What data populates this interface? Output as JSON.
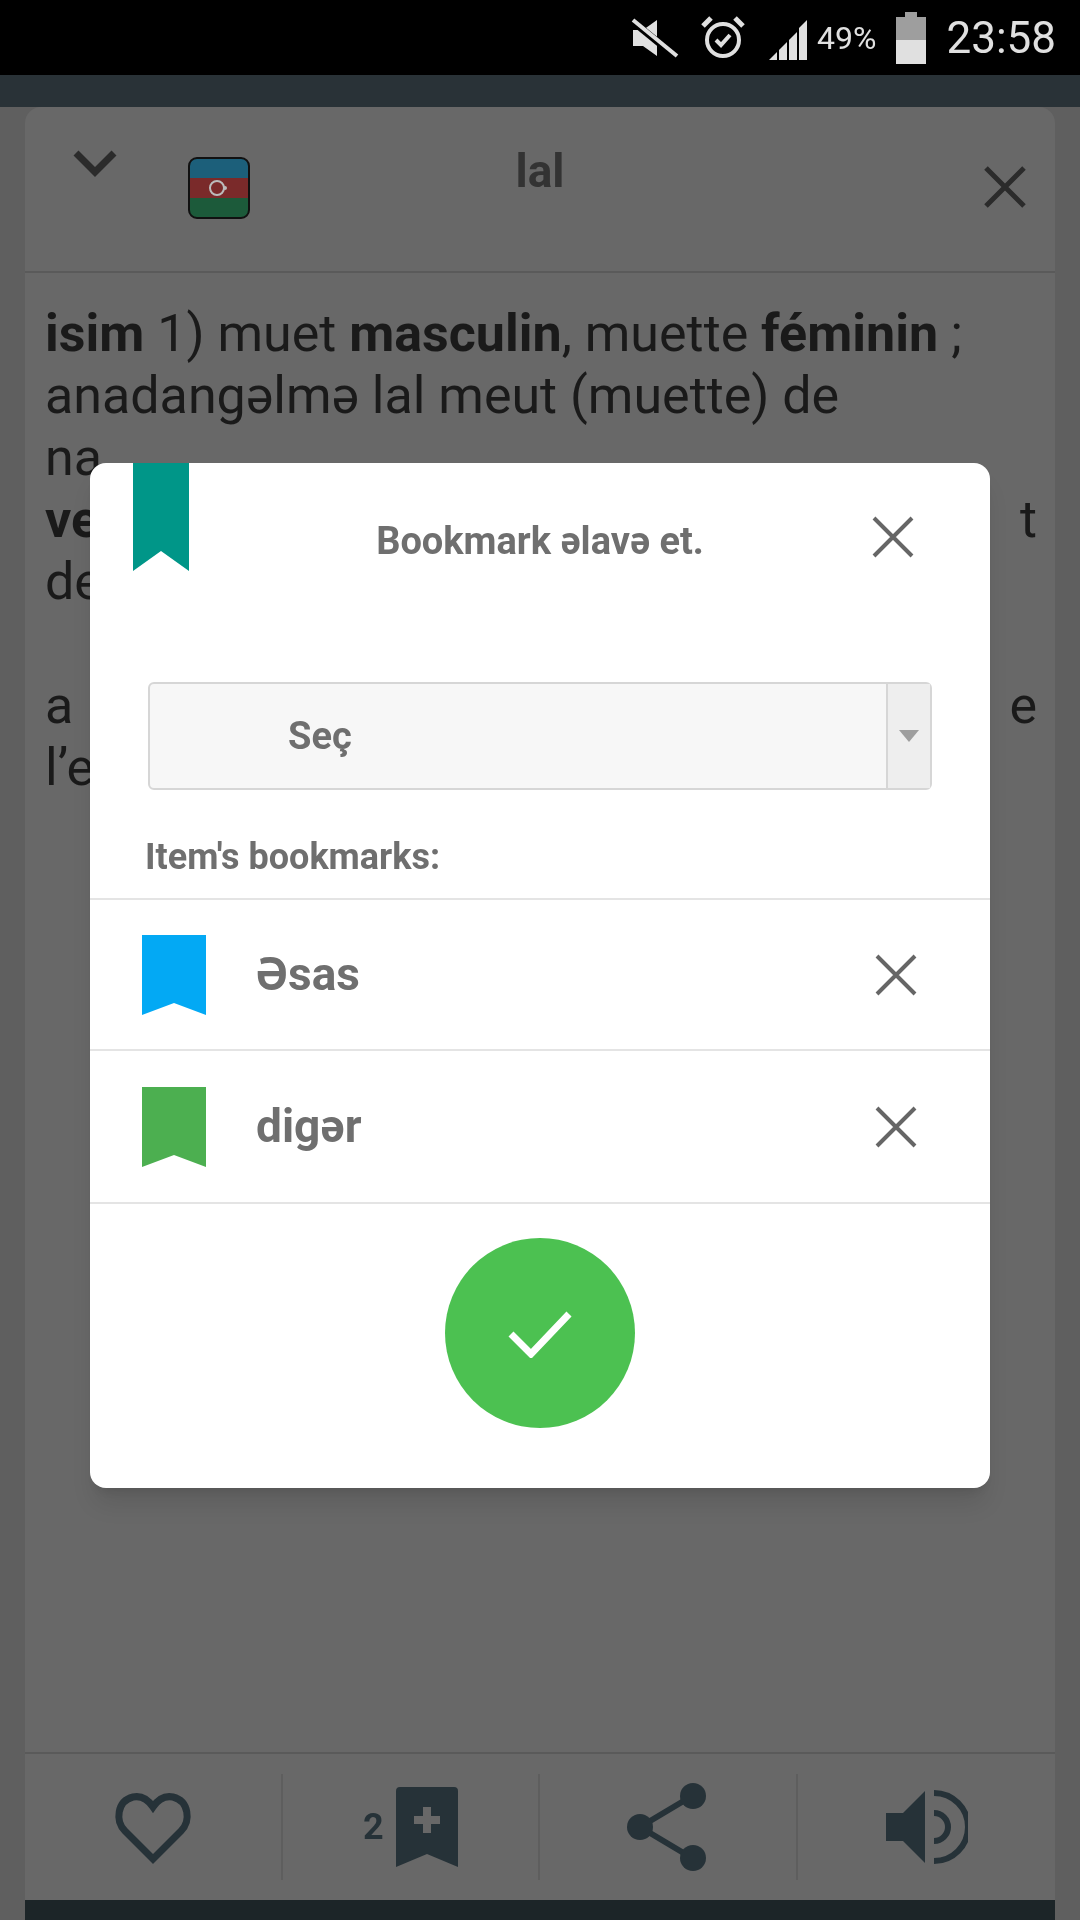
{
  "status_bar": {
    "battery_percent": "49%",
    "time": "23:58"
  },
  "entry": {
    "title": "lal",
    "paragraphs": [
      [
        {
          "left": "**isim** 1) muet **masculin**, muette **féminin** ;"
        },
        {
          "left": "anadangəlmə lal meut (muette) de"
        },
        {
          "left": "na"
        },
        {
          "left": "**ve**",
          "right": "t"
        },
        {
          "left": "de"
        }
      ],
      [
        {
          "left": "a",
          "right": "e"
        },
        {
          "left": "l’e"
        }
      ]
    ]
  },
  "bottom_bar": {
    "bookmark_count": "2"
  },
  "dialog": {
    "title": "Bookmark əlavə et.",
    "select": {
      "value": "Seç"
    },
    "list_label": "Item's bookmarks:",
    "bookmarks": [
      {
        "name": "Əsas",
        "color": "#03a9f4"
      },
      {
        "name": "digər",
        "color": "#4caf50"
      }
    ]
  }
}
